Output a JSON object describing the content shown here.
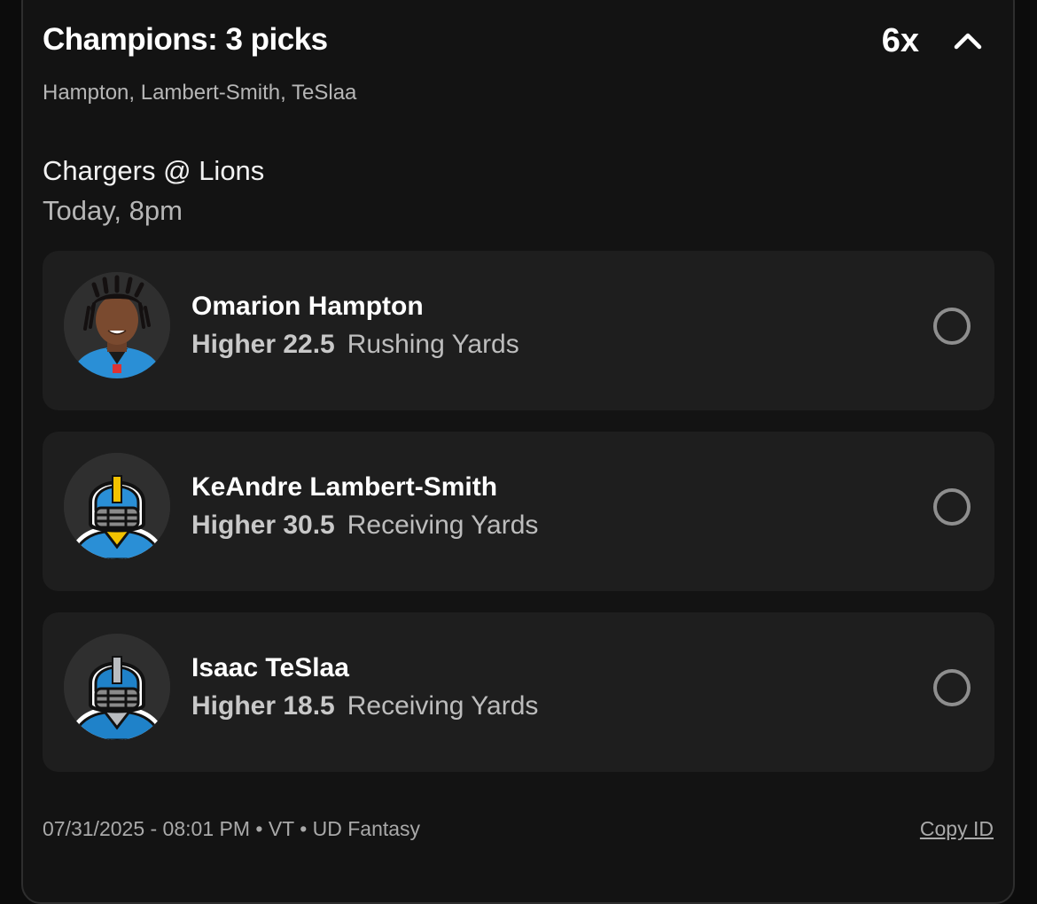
{
  "entry": {
    "title": "Champions: 3 picks",
    "multiplier": "6x",
    "players_summary": "Hampton, Lambert-Smith, TeSlaa",
    "collapse_icon": "chevron-up-icon"
  },
  "game": {
    "matchup": "Chargers @ Lions",
    "time": "Today, 8pm"
  },
  "picks": [
    {
      "player": "Omarion Hampton",
      "direction_value": "Higher 22.5",
      "stat": "Rushing Yards",
      "avatar": "player-photo",
      "selected": false
    },
    {
      "player": "KeAndre Lambert-Smith",
      "direction_value": "Higher 30.5",
      "stat": "Receiving Yards",
      "avatar": "helmet-icon",
      "selected": false
    },
    {
      "player": "Isaac TeSlaa",
      "direction_value": "Higher 18.5",
      "stat": "Receiving Yards",
      "avatar": "helmet-icon",
      "selected": false
    }
  ],
  "footer": {
    "meta": "07/31/2025 - 08:01 PM • VT • UD Fantasy",
    "copy_label": "Copy ID"
  },
  "colors": {
    "background": "#0c0c0c",
    "card": "#131313",
    "pick_row": "#1e1e1e",
    "chargers_blue": "#2a8fd6",
    "chargers_gold": "#f2c200",
    "lions_blue": "#1f82c9",
    "lions_silver": "#b9bcc0"
  }
}
